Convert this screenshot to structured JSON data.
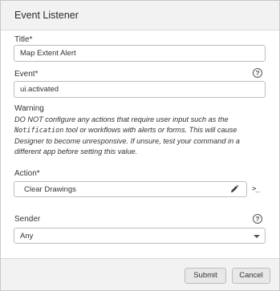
{
  "dialog": {
    "title": "Event Listener"
  },
  "fields": {
    "title_label": "Title*",
    "title_value": "Map Extent Alert",
    "event_label": "Event*",
    "event_value": "ui.activated",
    "help_glyph": "?"
  },
  "warning": {
    "title": "Warning",
    "text_before": "DO NOT configure any actions that require user input such as the ",
    "code": "Notification",
    "text_after": " tool or workflows with alerts or forms. This will cause Designer to become unresponsive. If unsure, test your command in a different app before setting this value."
  },
  "action": {
    "label": "Action*",
    "value": "Clear Drawings",
    "edit_icon": "pencil-icon",
    "terminal_glyph": ">_"
  },
  "sender": {
    "label": "Sender",
    "selected": "Any"
  },
  "footer": {
    "submit_label": "Submit",
    "cancel_label": "Cancel"
  },
  "colors": {
    "header_bg": "#f2f2f2",
    "border": "#bdbdbd",
    "button_bg": "#e8e8e8",
    "text": "#333333"
  }
}
